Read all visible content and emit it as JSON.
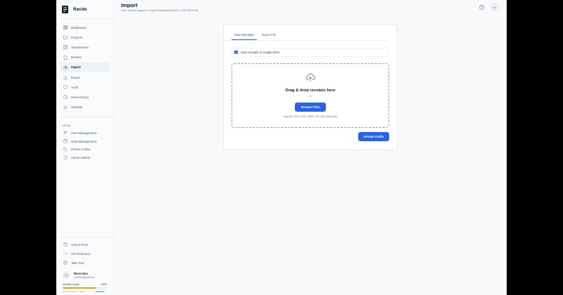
{
  "app": {
    "name": "Recite"
  },
  "sidebar": {
    "items": [
      {
        "label": "Dashboard",
        "icon": "dashboard-icon"
      },
      {
        "label": "Projects",
        "icon": "folder-icon"
      },
      {
        "label": "Transactions",
        "icon": "list-icon"
      },
      {
        "label": "Review",
        "icon": "document-icon"
      },
      {
        "label": "Import",
        "icon": "cloud-upload-icon",
        "active": true
      },
      {
        "label": "Export",
        "icon": "download-icon"
      },
      {
        "label": "Audit",
        "icon": "shield-icon"
      },
      {
        "label": "Scan History",
        "icon": "clock-icon"
      },
      {
        "label": "Settings",
        "icon": "gear-icon"
      }
    ],
    "admin_label": "ADMIN",
    "admin_items": [
      {
        "label": "User Management",
        "icon": "users-icon"
      },
      {
        "label": "Data Management",
        "icon": "database-icon"
      },
      {
        "label": "Promo Codes",
        "icon": "tag-icon"
      },
      {
        "label": "Admin History",
        "icon": "history-icon"
      }
    ],
    "bottom_items": [
      {
        "label": "Help & Docs",
        "icon": "help-icon"
      },
      {
        "label": "API Reference",
        "icon": "code-icon"
      },
      {
        "label": "Take Tour",
        "icon": "compass-icon"
      }
    ],
    "user": {
      "initial": "U",
      "name": "Rivra Dev",
      "email": "rivradev@gmail.com"
    },
    "usage": {
      "label": "Monthly Usage",
      "count": "15/20",
      "fraction": 0.75,
      "reset": "Resets March 1 • 2026",
      "upgrade": "Upgrade →"
    }
  },
  "header": {
    "title": "Import",
    "subtitle": "Scan receipt images or import transactions from a CSV/JSON file.",
    "avatar_initial": "U"
  },
  "import_card": {
    "tabs": [
      {
        "label": "Scan Receipts",
        "active": true
      },
      {
        "label": "Import File",
        "active": false
      }
    ],
    "save_checkbox_label": "Save receipts to Google Drive",
    "save_checked": true,
    "drop_title": "Drag & drop receipts here",
    "drop_or": "or",
    "browse_label": "Browse Files",
    "supports_text": "Supports: JPEG, PNG, WEBP, PDF (Max 5MB each)",
    "review_label": "Review Drafts"
  },
  "colors": {
    "accent": "#2563eb",
    "usage_bar": "#f59e0b",
    "drop_border": "#60a5fa"
  }
}
